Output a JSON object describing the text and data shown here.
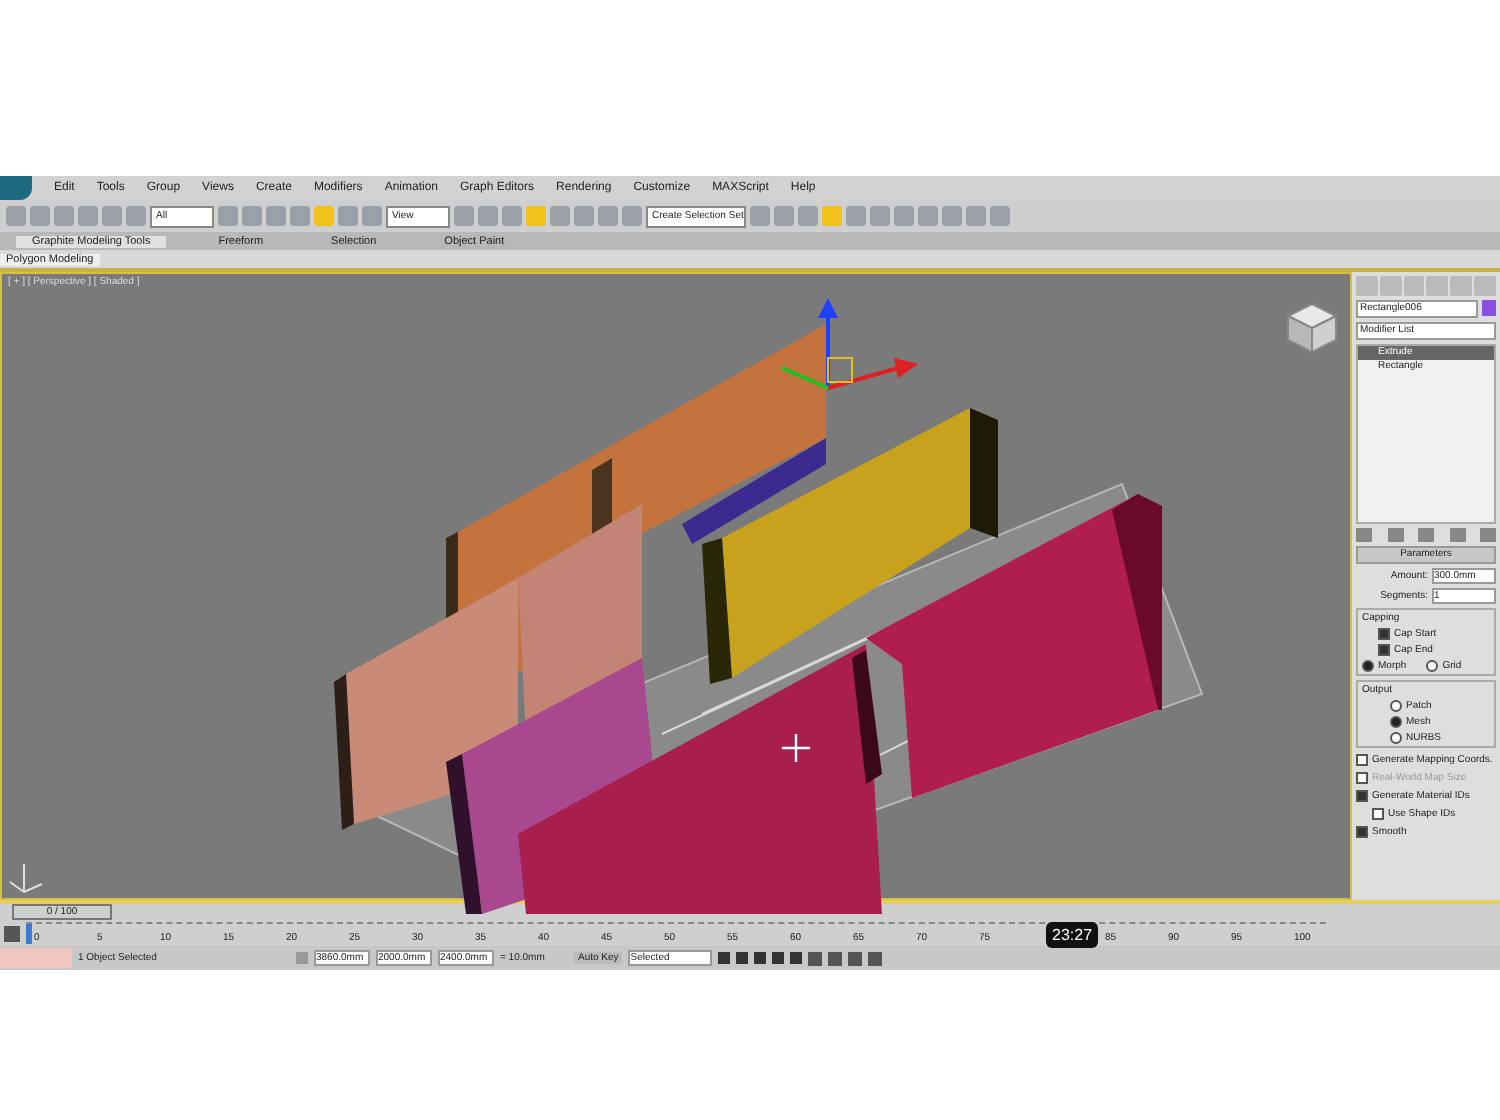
{
  "menu": [
    "Edit",
    "Tools",
    "Group",
    "Views",
    "Create",
    "Modifiers",
    "Animation",
    "Graph Editors",
    "Rendering",
    "Customize",
    "MAXScript",
    "Help"
  ],
  "toolbar": {
    "filter": "All",
    "coord": "View",
    "selection_set": "Create Selection Set"
  },
  "ribbon_tabs": [
    {
      "label": "Graphite Modeling Tools",
      "selected": true
    },
    {
      "label": "Freeform",
      "selected": false
    },
    {
      "label": "Selection",
      "selected": false
    },
    {
      "label": "Object Paint",
      "selected": false
    }
  ],
  "ribbon_panel": "Polygon Modeling",
  "viewport": {
    "label": "[ + ] [ Perspective ] [ Shaded ]"
  },
  "command_panel": {
    "object_name": "Rectangle006",
    "modifier_list": "Modifier List",
    "stack": [
      {
        "label": "Extrude",
        "selected": true
      },
      {
        "label": "Rectangle",
        "selected": false
      }
    ],
    "rollout": "Parameters",
    "amount_label": "Amount:",
    "amount": "300.0mm",
    "segments_label": "Segments:",
    "segments": "1",
    "capping": {
      "title": "Capping",
      "checks": [
        {
          "label": "Cap Start",
          "checked": true
        },
        {
          "label": "Cap End",
          "checked": true
        }
      ],
      "radios": [
        {
          "label": "Morph",
          "selected": true
        },
        {
          "label": "Grid",
          "selected": false
        }
      ]
    },
    "output": {
      "title": "Output",
      "radios": [
        {
          "label": "Patch",
          "selected": false
        },
        {
          "label": "Mesh",
          "selected": true
        },
        {
          "label": "NURBS",
          "selected": false
        }
      ]
    },
    "options": [
      {
        "label": "Generate Mapping Coords.",
        "checked": false,
        "disabled": false,
        "indent": false
      },
      {
        "label": "Real-World Map Size",
        "checked": false,
        "disabled": true,
        "indent": false
      },
      {
        "label": "Generate Material IDs",
        "checked": true,
        "disabled": false,
        "indent": false
      },
      {
        "label": "Use Shape IDs",
        "checked": false,
        "disabled": false,
        "indent": true
      },
      {
        "label": "Smooth",
        "checked": true,
        "disabled": false,
        "indent": false
      }
    ]
  },
  "timeline": {
    "slider": "0 / 100",
    "level": 0,
    "ticks": [
      "0",
      "5",
      "10",
      "15",
      "20",
      "25",
      "30",
      "35",
      "40",
      "45",
      "50",
      "55",
      "60",
      "65",
      "70",
      "75",
      "85",
      "90",
      "95",
      "100"
    ]
  },
  "status": {
    "message": "1 Object Selected",
    "x": "3860.0mm",
    "y": "2000.0mm",
    "z": "2400.0mm",
    "grid": "= 10.0mm",
    "auto_key": "Auto Key",
    "key_filter": "Selected"
  },
  "video_time": "23:27"
}
